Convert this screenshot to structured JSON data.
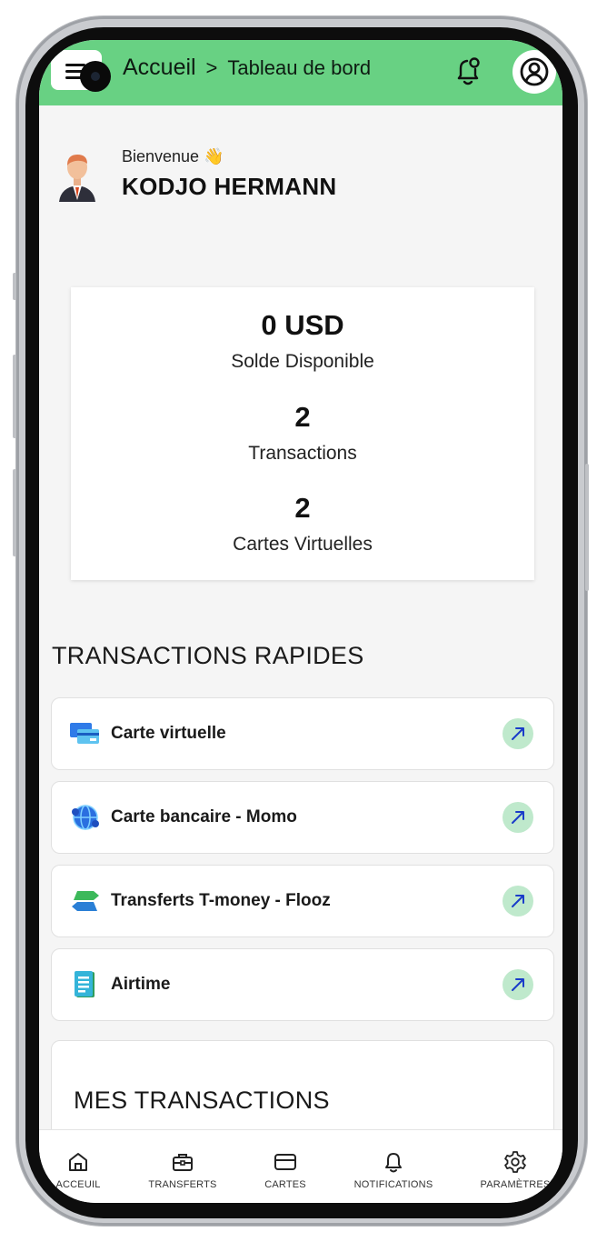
{
  "header": {
    "breadcrumb_root": "Accueil",
    "breadcrumb_separator": ">",
    "breadcrumb_current": "Tableau de bord"
  },
  "welcome": {
    "greeting": "Bienvenue 👋",
    "user_name": "KODJO HERMANN"
  },
  "stats": {
    "balance_value": "0 USD",
    "balance_label": "Solde Disponible",
    "transactions_value": "2",
    "transactions_label": "Transactions",
    "cards_value": "2",
    "cards_label": "Cartes Virtuelles"
  },
  "quick_transactions": {
    "title": "TRANSACTIONS RAPIDES",
    "items": [
      {
        "label": "Carte virtuelle",
        "icon": "virtual-card-icon"
      },
      {
        "label": "Carte bancaire - Momo",
        "icon": "globe-icon"
      },
      {
        "label": "Transferts T-money - Flooz",
        "icon": "transfer-arrows-icon"
      },
      {
        "label": "Airtime",
        "icon": "document-icon"
      }
    ]
  },
  "my_transactions": {
    "title": "MES TRANSACTIONS"
  },
  "bottom_nav": {
    "items": [
      {
        "label": "ACCEUIL",
        "icon": "home-icon"
      },
      {
        "label": "TRANSFERTS",
        "icon": "briefcase-icon"
      },
      {
        "label": "CARTES",
        "icon": "card-icon"
      },
      {
        "label": "NOTIFICATIONS",
        "icon": "bell-icon"
      },
      {
        "label": "PARAMÈTRES",
        "icon": "gear-icon"
      }
    ]
  },
  "colors": {
    "header_bg": "#68d183",
    "arrow_bg": "#bfe9cc",
    "arrow_fg": "#1a3cc9"
  }
}
